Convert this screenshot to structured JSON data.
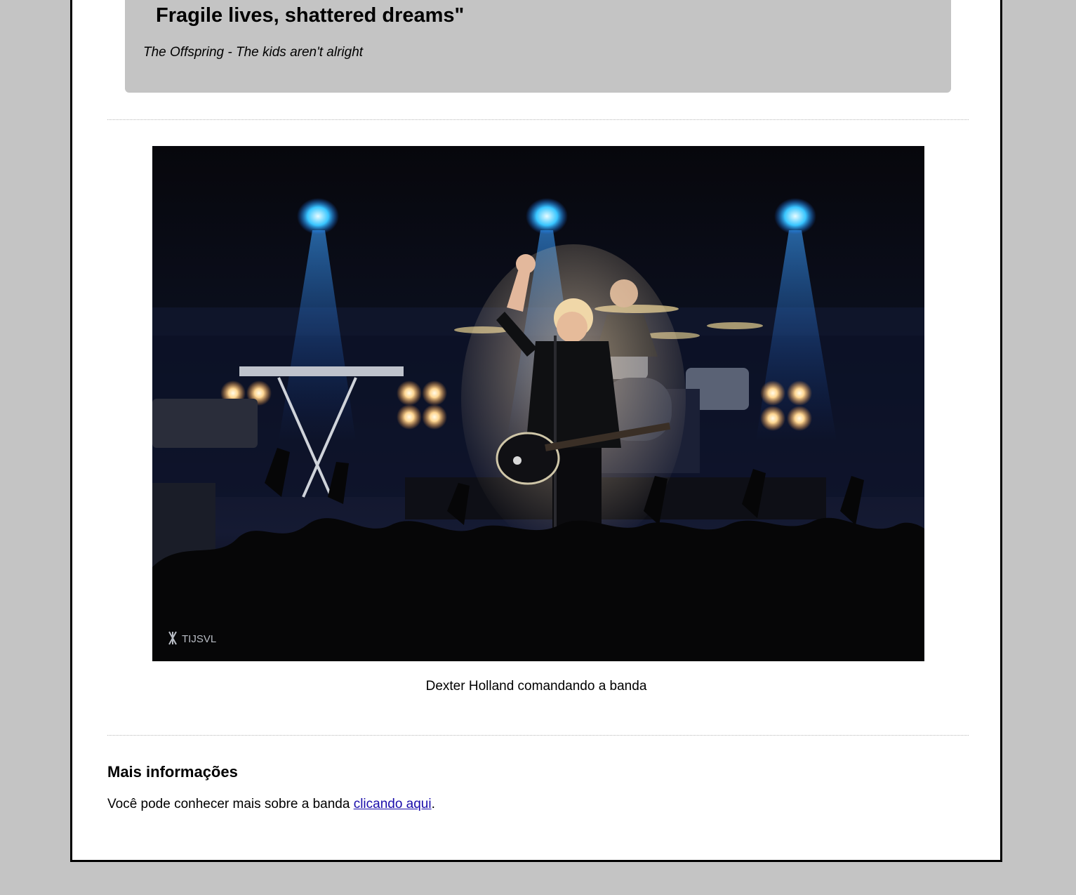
{
  "quote": {
    "last_line": "Fragile lives, shattered dreams\"",
    "citation": "The Offspring - The kids aren't alright"
  },
  "figure": {
    "image_alt": "Dexter Holland comandando a banda",
    "watermark": "TIJSVL",
    "caption": "Dexter Holland comandando a banda"
  },
  "more_info": {
    "title": "Mais informações",
    "text_before": "Você pode conhecer mais sobre a banda ",
    "link_label": "clicando aqui",
    "text_after": "."
  },
  "colors": {
    "page_background": "#c4c4c4",
    "content_background": "#ffffff",
    "quote_background": "#c4c4c4",
    "link": "#1a0dab",
    "stage_light_blue": "#2aa8ff",
    "stage_light_warm": "#ffd9a0"
  }
}
